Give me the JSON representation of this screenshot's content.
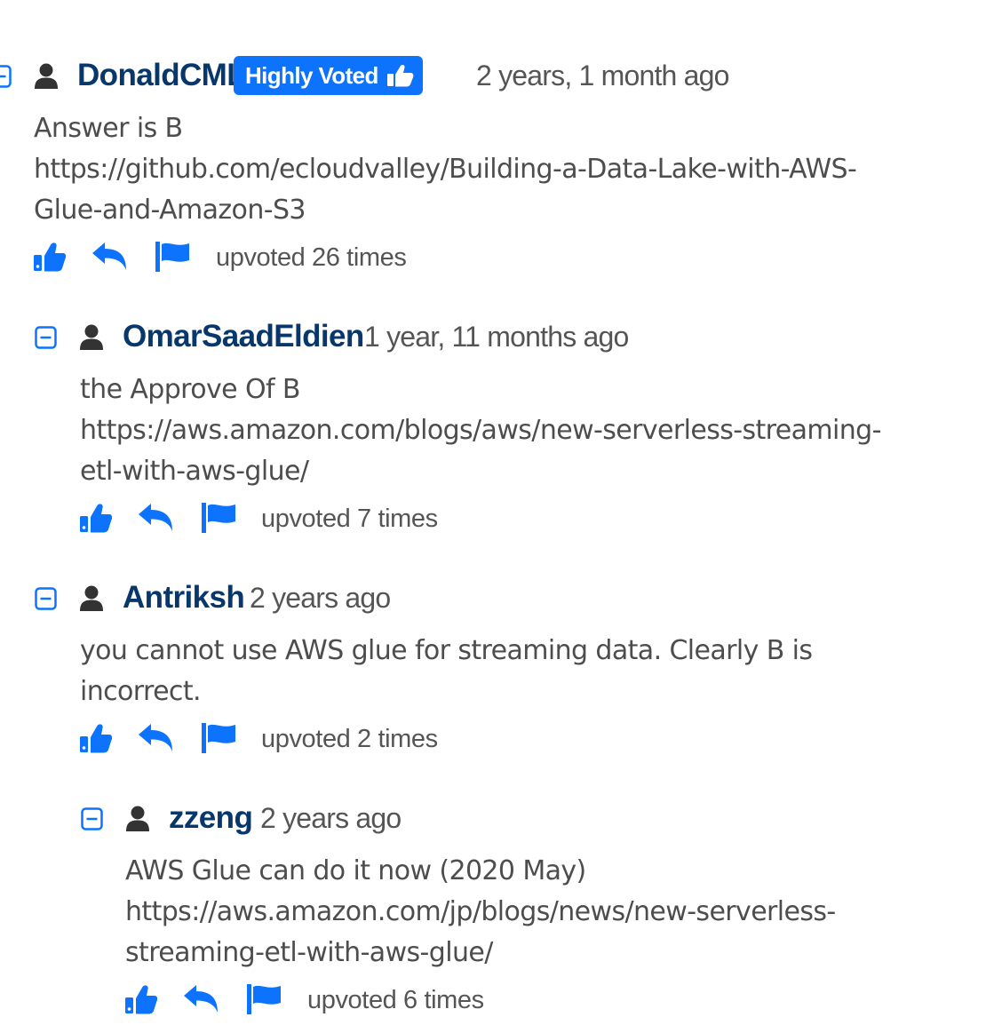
{
  "comments": [
    {
      "username": "DonaldCMLIN",
      "badge": "Highly Voted",
      "ago": "2 years, 1 month ago",
      "lines": [
        "Answer is B",
        "https://github.com/ecloudvalley/Building-a-Data-Lake-with-AWS-",
        "Glue-and-Amazon-S3"
      ],
      "upvotes": "upvoted 26 times"
    },
    {
      "username": "OmarSaadEldien",
      "ago": "1 year, 11 months ago",
      "lines": [
        "the Approve Of B",
        "https://aws.amazon.com/blogs/aws/new-serverless-streaming-",
        "etl-with-aws-glue/"
      ],
      "upvotes": "upvoted 7 times"
    },
    {
      "username": "Antriksh",
      "ago": "2 years ago",
      "lines": [
        "you cannot use AWS glue for streaming data. Clearly B is",
        "incorrect."
      ],
      "upvotes": "upvoted 2 times"
    },
    {
      "username": "zzeng",
      "ago": "2 years ago",
      "lines": [
        "AWS Glue can do it now (2020 May)",
        "https://aws.amazon.com/jp/blogs/news/new-serverless-",
        "streaming-etl-with-aws-glue/"
      ],
      "upvotes": "upvoted 6 times"
    }
  ],
  "icons": {
    "collapse": "minus-square-icon",
    "user": "user-icon",
    "upvote": "thumbs-up-icon",
    "reply": "reply-icon",
    "report": "flag-icon"
  },
  "colors": {
    "accent": "#0d73fd",
    "username": "#07376b",
    "muted": "#555555",
    "body": "#4d4d4d",
    "user_icon": "#333333"
  }
}
